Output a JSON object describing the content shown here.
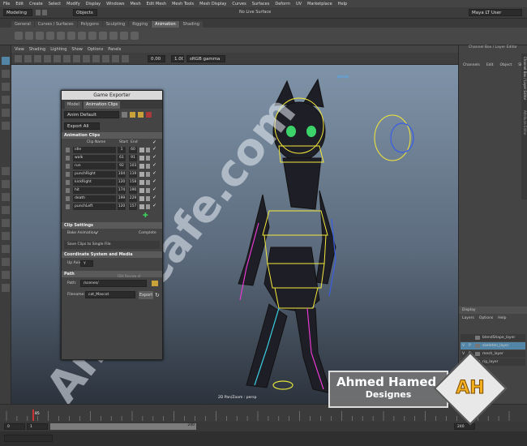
{
  "menu": [
    "File",
    "Edit",
    "Create",
    "Select",
    "Modify",
    "Display",
    "Windows",
    "Mesh",
    "Edit Mesh",
    "Mesh Tools",
    "Mesh Display",
    "Curves",
    "Surfaces",
    "Deform",
    "UV",
    "Marketplace",
    "Help"
  ],
  "status": {
    "mode": "Modeling",
    "objects": "Objects",
    "surface": "No Live Surface",
    "user": "Maya LT User"
  },
  "shelf_tabs": [
    "General",
    "Curves / Surfaces",
    "Polygons",
    "Sculpting",
    "Rigging",
    "Animation",
    "Shading"
  ],
  "shelf_active": "Animation",
  "panel_menu": [
    "View",
    "Shading",
    "Lighting",
    "Show",
    "Options",
    "Panels"
  ],
  "panel_toolbar": {
    "exposure": "0.00",
    "gamma": "1.00",
    "colorspace": "sRGB gamma"
  },
  "viewport": {
    "pan_zoom_label": "2D Pan/Zoom : persp",
    "camera_label": "persp"
  },
  "channel_box": {
    "title": "Channel Box / Layer Editor",
    "menus": [
      "Channels",
      "Edit",
      "Object",
      "Show"
    ],
    "side_tabs": [
      "Channel Box / Layer Editor",
      "Attribute Editor"
    ]
  },
  "layer_editor": {
    "header": "Display",
    "menus": [
      "Layers",
      "Options",
      "Help"
    ],
    "layers": [
      {
        "name": "blendShape_layer",
        "v": "",
        "p": ""
      },
      {
        "name": "skeleton_layer",
        "v": "V",
        "p": "P"
      },
      {
        "name": "mesh_layer",
        "v": "V",
        "p": "P"
      },
      {
        "name": "rig_layer",
        "v": "V",
        "p": ""
      }
    ]
  },
  "exporter": {
    "title": "Game Exporter",
    "tabs": [
      "Model",
      "Animation Clips"
    ],
    "active_tab": "Animation Clips",
    "preset": "Anim Default",
    "export_mode": "Export All",
    "section_clips": "Animation Clips",
    "col_headers": {
      "name": "Clip Name",
      "start": "Start",
      "end": "End"
    },
    "clips": [
      {
        "name": "idle",
        "start": "1",
        "end": "60"
      },
      {
        "name": "walk",
        "start": "61",
        "end": "91"
      },
      {
        "name": "run",
        "start": "92",
        "end": "103"
      },
      {
        "name": "punchRight",
        "start": "104",
        "end": "119"
      },
      {
        "name": "kickRight",
        "start": "120",
        "end": "158"
      },
      {
        "name": "hit",
        "start": "174",
        "end": "190"
      },
      {
        "name": "death",
        "start": "199",
        "end": "229"
      },
      {
        "name": "punchLeft",
        "start": "120",
        "end": "157"
      }
    ],
    "section_settings": "Clip Settings",
    "bake_animation": "Bake Animation",
    "bake_check": "✓",
    "complete": "Complete",
    "save_clips": "Save Clips to Single File",
    "section_coord": "Coordinate System and Media",
    "up_axis_label": "Up Axis",
    "up_axis_value": "Y",
    "section_path": "Path",
    "path_label": "Path:",
    "path_value": "/scenes/",
    "path_note": "FBX Review of",
    "filename_label": "Filename:",
    "filename_value": "cat_Mascot",
    "export_btn": "Export"
  },
  "timeslider": {
    "start": "0",
    "end": "240",
    "current": "85",
    "range_start": "0",
    "range_start2": "1",
    "range_end": "240",
    "range_end2": "240"
  },
  "watermark": {
    "name": "Ahmed Hamed",
    "sub": "Designes",
    "logo": "AH",
    "diagonal": "Anim-Cafe.com"
  },
  "colors": {
    "viewport_top": "#7f93a8",
    "viewport_bottom": "#2c333d",
    "rig_yellow": "#f4e93a",
    "active_tab": "#5d5d5d",
    "accent_blue": "#5285a6"
  }
}
